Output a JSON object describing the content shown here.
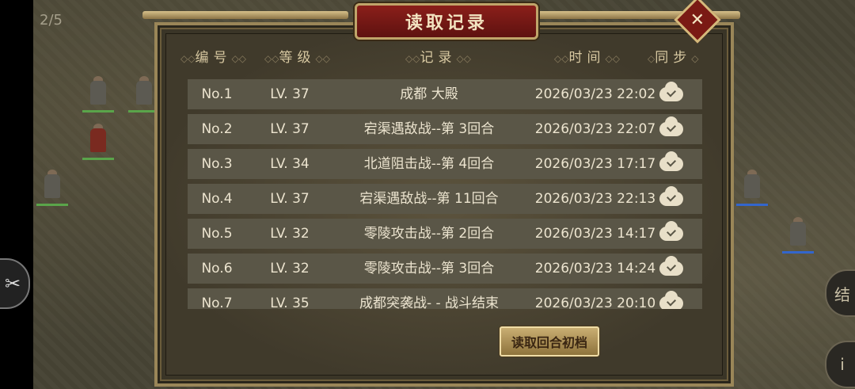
{
  "page_indicator": "2/5",
  "dialog": {
    "title": "读取记录",
    "close_symbol": "✕"
  },
  "columns": {
    "no": "编号",
    "level": "等级",
    "record": "记录",
    "time": "时间",
    "sync": "同步"
  },
  "rows": [
    {
      "no": "No.1",
      "level": "LV. 37",
      "record": "成都  大殿",
      "time": "2026/03/23 22:02",
      "sync_icon": "cloud-check-icon"
    },
    {
      "no": "No.2",
      "level": "LV. 37",
      "record": "宕渠遇敌战--第 3回合",
      "time": "2026/03/23 22:07",
      "sync_icon": "cloud-check-icon"
    },
    {
      "no": "No.3",
      "level": "LV. 34",
      "record": "北道阻击战--第 4回合",
      "time": "2026/03/23 17:17",
      "sync_icon": "cloud-check-icon"
    },
    {
      "no": "No.4",
      "level": "LV. 37",
      "record": "宕渠遇敌战--第 11回合",
      "time": "2026/03/23 22:13",
      "sync_icon": "cloud-check-icon"
    },
    {
      "no": "No.5",
      "level": "LV. 32",
      "record": "零陵攻击战--第 2回合",
      "time": "2026/03/23 14:17",
      "sync_icon": "cloud-check-icon"
    },
    {
      "no": "No.6",
      "level": "LV. 32",
      "record": "零陵攻击战--第 3回合",
      "time": "2026/03/23 14:24",
      "sync_icon": "cloud-check-icon"
    },
    {
      "no": "No.7",
      "level": "LV. 35",
      "record": "成都突袭战- - 战斗结束",
      "time": "2026/03/23 20:10",
      "sync_icon": "cloud-check-icon"
    }
  ],
  "load_button": "读取回合初档",
  "side_right_top": "结",
  "side_right_bottom": "i",
  "side_left": "✂"
}
